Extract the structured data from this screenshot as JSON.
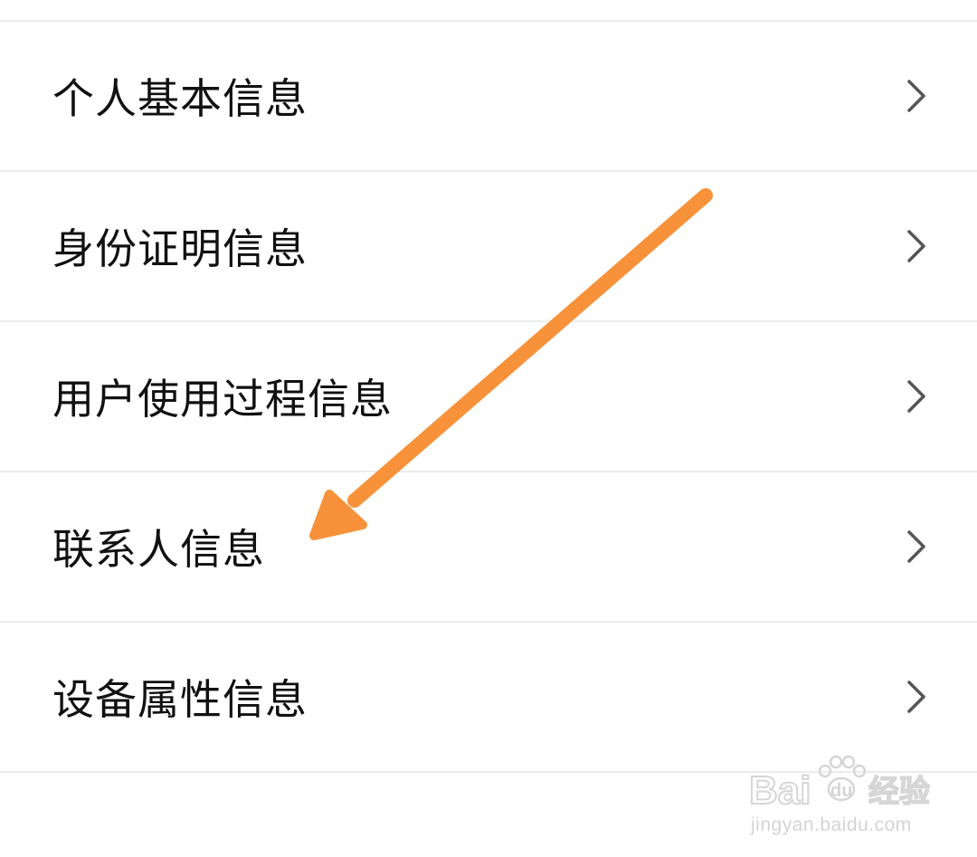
{
  "list": {
    "items": [
      {
        "label": "个人基本信息",
        "icon": "chevron-right-icon"
      },
      {
        "label": "身份证明信息",
        "icon": "chevron-right-icon"
      },
      {
        "label": "用户使用过程信息",
        "icon": "chevron-right-icon"
      },
      {
        "label": "联系人信息",
        "icon": "chevron-right-icon"
      },
      {
        "label": "设备属性信息",
        "icon": "chevron-right-icon"
      }
    ]
  },
  "annotation": {
    "icon": "arrow-annotation",
    "color": "#f7923a"
  },
  "watermark": {
    "logo_text": "Baidu经验",
    "url": "jingyan.baidu.com"
  },
  "colors": {
    "text": "#111111",
    "divider": "#ececec",
    "chevron": "#555555",
    "background": "#ffffff"
  }
}
